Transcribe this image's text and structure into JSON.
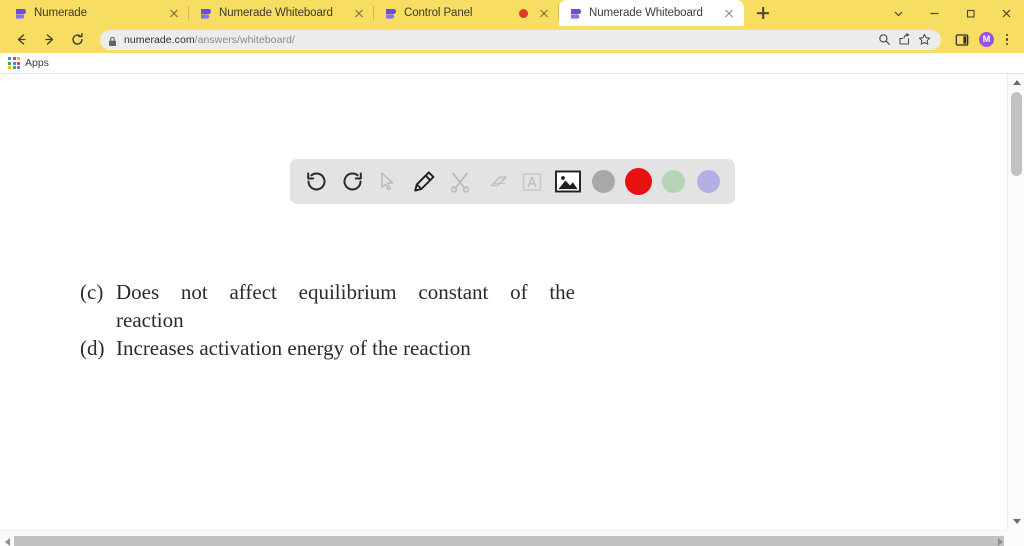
{
  "window": {
    "chrome_color": "#f7dd62",
    "controls": [
      {
        "name": "chevron-down",
        "label": "⌄"
      },
      {
        "name": "minimize",
        "label": "—"
      },
      {
        "name": "maximize",
        "label": "□"
      },
      {
        "name": "close",
        "label": "✕"
      }
    ]
  },
  "tabs": [
    {
      "title": "Numerade",
      "active": false,
      "recording": false,
      "favicon": "numerade-logo"
    },
    {
      "title": "Numerade Whiteboard",
      "active": false,
      "recording": false,
      "favicon": "numerade-logo"
    },
    {
      "title": "Control Panel",
      "active": false,
      "recording": true,
      "favicon": "numerade-logo"
    },
    {
      "title": "Numerade Whiteboard",
      "active": true,
      "recording": false,
      "favicon": "numerade-logo"
    }
  ],
  "newtab_label": "New tab",
  "navigation": {
    "back_label": "Back",
    "forward_label": "Forward",
    "reload_label": "Reload",
    "url_host": "numerade.com",
    "url_path": "/answers/whiteboard/",
    "url_full": "numerade.com/answers/whiteboard/",
    "secure": true,
    "omnibox_icons": [
      {
        "name": "search-icon"
      },
      {
        "name": "share-icon"
      },
      {
        "name": "bookmark-star-icon"
      }
    ],
    "side_panel_label": "Side panel",
    "profile_initial": "M",
    "profile_color": "#9b51e0",
    "menu_label": "Customize and control"
  },
  "bookmarks": {
    "items": [
      {
        "label": "Apps",
        "icon": "apps-grid-icon"
      }
    ]
  },
  "whiteboard": {
    "toolbar": {
      "background": "#e3e3e3",
      "tools": [
        {
          "name": "undo-icon",
          "label": "Undo",
          "enabled": true
        },
        {
          "name": "redo-icon",
          "label": "Redo",
          "enabled": true
        },
        {
          "name": "cursor-icon",
          "label": "Select",
          "enabled": false
        },
        {
          "name": "pencil-icon",
          "label": "Pen",
          "enabled": true
        },
        {
          "name": "shapes-icon",
          "label": "Shapes",
          "enabled": false
        },
        {
          "name": "eraser-icon",
          "label": "Eraser",
          "enabled": false
        },
        {
          "name": "text-icon",
          "label": "Text",
          "enabled": false
        },
        {
          "name": "image-icon",
          "label": "Insert image",
          "enabled": true
        }
      ],
      "colors": [
        {
          "name": "gray",
          "hex": "#a8a8a8",
          "selected": false
        },
        {
          "name": "red",
          "hex": "#e81010",
          "selected": true
        },
        {
          "name": "green",
          "hex": "#b6d3b6",
          "selected": false
        },
        {
          "name": "purple",
          "hex": "#b2b0e4",
          "selected": false
        }
      ]
    },
    "content": {
      "lines": [
        {
          "label": "(c)",
          "text": "Does not affect equilibrium constant of the",
          "justify": true
        },
        {
          "label": "",
          "text": "reaction",
          "justify": false
        },
        {
          "label": "(d)",
          "text": "Increases activation energy of the reaction",
          "justify": false
        }
      ]
    }
  },
  "scrollbars": {
    "vertical_label": "Vertical scrollbar",
    "horizontal_label": "Horizontal scrollbar"
  }
}
